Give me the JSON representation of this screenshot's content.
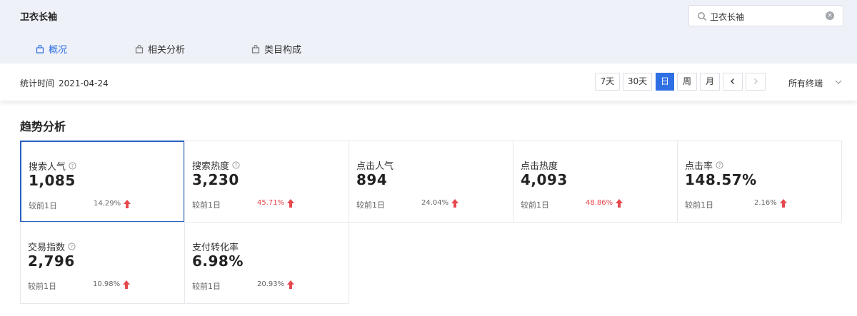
{
  "header": {
    "title": "卫衣长袖",
    "search": {
      "value": "卫衣长袖"
    }
  },
  "tabs": [
    {
      "label": "概况",
      "active": true
    },
    {
      "label": "相关分析",
      "active": false
    },
    {
      "label": "类目构成",
      "active": false
    }
  ],
  "toolbar": {
    "stat_label": "统计时间",
    "stat_date": "2021-04-24",
    "periods": [
      "7天",
      "30天",
      "日",
      "周",
      "月"
    ],
    "active_period": "日",
    "terminal": "所有终端"
  },
  "section": {
    "title": "趋势分析"
  },
  "metrics": [
    {
      "label": "搜索人气",
      "value": "1,085",
      "compare": "较前1日",
      "pct": "14.29%",
      "pct_color": "gray",
      "has_help": true,
      "selected": true
    },
    {
      "label": "搜索热度",
      "value": "3,230",
      "compare": "较前1日",
      "pct": "45.71%",
      "pct_color": "red",
      "has_help": true
    },
    {
      "label": "点击人气",
      "value": "894",
      "compare": "较前1日",
      "pct": "24.04%",
      "pct_color": "gray",
      "has_help": false
    },
    {
      "label": "点击热度",
      "value": "4,093",
      "compare": "较前1日",
      "pct": "48.86%",
      "pct_color": "red",
      "has_help": false
    },
    {
      "label": "点击率",
      "value": "148.57%",
      "compare": "较前1日",
      "pct": "2.16%",
      "pct_color": "gray",
      "has_help": true
    },
    {
      "label": "交易指数",
      "value": "2,796",
      "compare": "较前1日",
      "pct": "10.98%",
      "pct_color": "gray",
      "has_help": true
    },
    {
      "label": "支付转化率",
      "value": "6.98%",
      "compare": "较前1日",
      "pct": "20.93%",
      "pct_color": "gray",
      "has_help": false
    }
  ],
  "colors": {
    "accent": "#2f6fe4",
    "up_arrow": "#e5484d"
  }
}
